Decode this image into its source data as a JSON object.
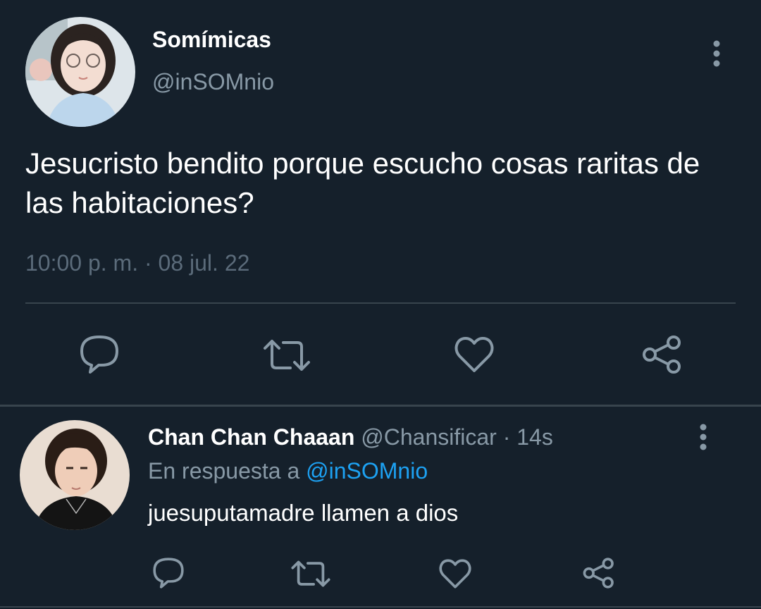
{
  "main_tweet": {
    "author_name": "Somímicas",
    "author_handle": "@inSOMnio",
    "text": "Jesucristo bendito porque escucho cosas raritas de las habitaciones?",
    "timestamp": "10:00 p. m. · 08 jul. 22",
    "avatar_icon": "avatar-photo-woman",
    "more_icon": "vertical-dots-icon",
    "actions": [
      "reply-icon",
      "retweet-icon",
      "like-icon",
      "share-icon"
    ]
  },
  "reply": {
    "author_name": "Chan Chan Chaaan",
    "author_handle": "@Chansificar",
    "separator": " · ",
    "time": "14s",
    "in_reply_prefix": "En respuesta a",
    "in_reply_handle": "@inSOMnio",
    "text": "juesuputamadre llamen a dios",
    "avatar_icon": "avatar-photo-man",
    "more_icon": "vertical-dots-icon",
    "actions": [
      "reply-icon",
      "retweet-icon",
      "like-icon",
      "share-icon"
    ]
  },
  "colors": {
    "background": "#15202b",
    "primary_text": "#ffffff",
    "secondary_text": "#8899a6",
    "timestamp_text": "#5b6b7a",
    "icon": "#8899a6",
    "link": "#1da1f2",
    "divider": "#38444d"
  }
}
